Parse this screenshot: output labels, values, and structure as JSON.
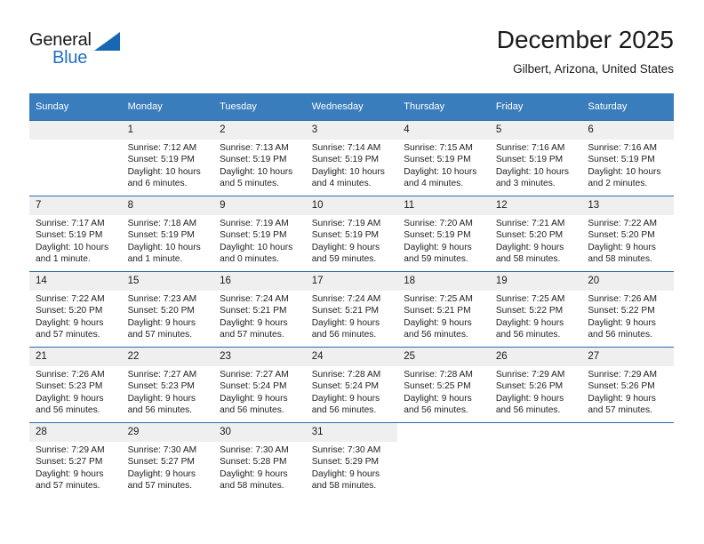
{
  "brand": {
    "name_part1": "General",
    "name_part2": "Blue",
    "triangle_icon": "triangle-icon",
    "accent_color": "#1668b3"
  },
  "header": {
    "title": "December 2025",
    "subtitle": "Gilbert, Arizona, United States"
  },
  "theme": {
    "header_bar_color": "#3a7dbd",
    "row_divider_color": "#2a6cad",
    "daynum_band_color": "#efefef"
  },
  "calendar": {
    "weekday_headers": [
      "Sunday",
      "Monday",
      "Tuesday",
      "Wednesday",
      "Thursday",
      "Friday",
      "Saturday"
    ],
    "weeks": [
      [
        {
          "day": "",
          "sunrise": "",
          "sunset": "",
          "daylight_line1": "",
          "daylight_line2": ""
        },
        {
          "day": "1",
          "sunrise": "Sunrise: 7:12 AM",
          "sunset": "Sunset: 5:19 PM",
          "daylight_line1": "Daylight: 10 hours",
          "daylight_line2": "and 6 minutes."
        },
        {
          "day": "2",
          "sunrise": "Sunrise: 7:13 AM",
          "sunset": "Sunset: 5:19 PM",
          "daylight_line1": "Daylight: 10 hours",
          "daylight_line2": "and 5 minutes."
        },
        {
          "day": "3",
          "sunrise": "Sunrise: 7:14 AM",
          "sunset": "Sunset: 5:19 PM",
          "daylight_line1": "Daylight: 10 hours",
          "daylight_line2": "and 4 minutes."
        },
        {
          "day": "4",
          "sunrise": "Sunrise: 7:15 AM",
          "sunset": "Sunset: 5:19 PM",
          "daylight_line1": "Daylight: 10 hours",
          "daylight_line2": "and 4 minutes."
        },
        {
          "day": "5",
          "sunrise": "Sunrise: 7:16 AM",
          "sunset": "Sunset: 5:19 PM",
          "daylight_line1": "Daylight: 10 hours",
          "daylight_line2": "and 3 minutes."
        },
        {
          "day": "6",
          "sunrise": "Sunrise: 7:16 AM",
          "sunset": "Sunset: 5:19 PM",
          "daylight_line1": "Daylight: 10 hours",
          "daylight_line2": "and 2 minutes."
        }
      ],
      [
        {
          "day": "7",
          "sunrise": "Sunrise: 7:17 AM",
          "sunset": "Sunset: 5:19 PM",
          "daylight_line1": "Daylight: 10 hours",
          "daylight_line2": "and 1 minute."
        },
        {
          "day": "8",
          "sunrise": "Sunrise: 7:18 AM",
          "sunset": "Sunset: 5:19 PM",
          "daylight_line1": "Daylight: 10 hours",
          "daylight_line2": "and 1 minute."
        },
        {
          "day": "9",
          "sunrise": "Sunrise: 7:19 AM",
          "sunset": "Sunset: 5:19 PM",
          "daylight_line1": "Daylight: 10 hours",
          "daylight_line2": "and 0 minutes."
        },
        {
          "day": "10",
          "sunrise": "Sunrise: 7:19 AM",
          "sunset": "Sunset: 5:19 PM",
          "daylight_line1": "Daylight: 9 hours",
          "daylight_line2": "and 59 minutes."
        },
        {
          "day": "11",
          "sunrise": "Sunrise: 7:20 AM",
          "sunset": "Sunset: 5:19 PM",
          "daylight_line1": "Daylight: 9 hours",
          "daylight_line2": "and 59 minutes."
        },
        {
          "day": "12",
          "sunrise": "Sunrise: 7:21 AM",
          "sunset": "Sunset: 5:20 PM",
          "daylight_line1": "Daylight: 9 hours",
          "daylight_line2": "and 58 minutes."
        },
        {
          "day": "13",
          "sunrise": "Sunrise: 7:22 AM",
          "sunset": "Sunset: 5:20 PM",
          "daylight_line1": "Daylight: 9 hours",
          "daylight_line2": "and 58 minutes."
        }
      ],
      [
        {
          "day": "14",
          "sunrise": "Sunrise: 7:22 AM",
          "sunset": "Sunset: 5:20 PM",
          "daylight_line1": "Daylight: 9 hours",
          "daylight_line2": "and 57 minutes."
        },
        {
          "day": "15",
          "sunrise": "Sunrise: 7:23 AM",
          "sunset": "Sunset: 5:20 PM",
          "daylight_line1": "Daylight: 9 hours",
          "daylight_line2": "and 57 minutes."
        },
        {
          "day": "16",
          "sunrise": "Sunrise: 7:24 AM",
          "sunset": "Sunset: 5:21 PM",
          "daylight_line1": "Daylight: 9 hours",
          "daylight_line2": "and 57 minutes."
        },
        {
          "day": "17",
          "sunrise": "Sunrise: 7:24 AM",
          "sunset": "Sunset: 5:21 PM",
          "daylight_line1": "Daylight: 9 hours",
          "daylight_line2": "and 56 minutes."
        },
        {
          "day": "18",
          "sunrise": "Sunrise: 7:25 AM",
          "sunset": "Sunset: 5:21 PM",
          "daylight_line1": "Daylight: 9 hours",
          "daylight_line2": "and 56 minutes."
        },
        {
          "day": "19",
          "sunrise": "Sunrise: 7:25 AM",
          "sunset": "Sunset: 5:22 PM",
          "daylight_line1": "Daylight: 9 hours",
          "daylight_line2": "and 56 minutes."
        },
        {
          "day": "20",
          "sunrise": "Sunrise: 7:26 AM",
          "sunset": "Sunset: 5:22 PM",
          "daylight_line1": "Daylight: 9 hours",
          "daylight_line2": "and 56 minutes."
        }
      ],
      [
        {
          "day": "21",
          "sunrise": "Sunrise: 7:26 AM",
          "sunset": "Sunset: 5:23 PM",
          "daylight_line1": "Daylight: 9 hours",
          "daylight_line2": "and 56 minutes."
        },
        {
          "day": "22",
          "sunrise": "Sunrise: 7:27 AM",
          "sunset": "Sunset: 5:23 PM",
          "daylight_line1": "Daylight: 9 hours",
          "daylight_line2": "and 56 minutes."
        },
        {
          "day": "23",
          "sunrise": "Sunrise: 7:27 AM",
          "sunset": "Sunset: 5:24 PM",
          "daylight_line1": "Daylight: 9 hours",
          "daylight_line2": "and 56 minutes."
        },
        {
          "day": "24",
          "sunrise": "Sunrise: 7:28 AM",
          "sunset": "Sunset: 5:24 PM",
          "daylight_line1": "Daylight: 9 hours",
          "daylight_line2": "and 56 minutes."
        },
        {
          "day": "25",
          "sunrise": "Sunrise: 7:28 AM",
          "sunset": "Sunset: 5:25 PM",
          "daylight_line1": "Daylight: 9 hours",
          "daylight_line2": "and 56 minutes."
        },
        {
          "day": "26",
          "sunrise": "Sunrise: 7:29 AM",
          "sunset": "Sunset: 5:26 PM",
          "daylight_line1": "Daylight: 9 hours",
          "daylight_line2": "and 56 minutes."
        },
        {
          "day": "27",
          "sunrise": "Sunrise: 7:29 AM",
          "sunset": "Sunset: 5:26 PM",
          "daylight_line1": "Daylight: 9 hours",
          "daylight_line2": "and 57 minutes."
        }
      ],
      [
        {
          "day": "28",
          "sunrise": "Sunrise: 7:29 AM",
          "sunset": "Sunset: 5:27 PM",
          "daylight_line1": "Daylight: 9 hours",
          "daylight_line2": "and 57 minutes."
        },
        {
          "day": "29",
          "sunrise": "Sunrise: 7:30 AM",
          "sunset": "Sunset: 5:27 PM",
          "daylight_line1": "Daylight: 9 hours",
          "daylight_line2": "and 57 minutes."
        },
        {
          "day": "30",
          "sunrise": "Sunrise: 7:30 AM",
          "sunset": "Sunset: 5:28 PM",
          "daylight_line1": "Daylight: 9 hours",
          "daylight_line2": "and 58 minutes."
        },
        {
          "day": "31",
          "sunrise": "Sunrise: 7:30 AM",
          "sunset": "Sunset: 5:29 PM",
          "daylight_line1": "Daylight: 9 hours",
          "daylight_line2": "and 58 minutes."
        },
        {
          "day": "",
          "sunrise": "",
          "sunset": "",
          "daylight_line1": "",
          "daylight_line2": ""
        },
        {
          "day": "",
          "sunrise": "",
          "sunset": "",
          "daylight_line1": "",
          "daylight_line2": ""
        },
        {
          "day": "",
          "sunrise": "",
          "sunset": "",
          "daylight_line1": "",
          "daylight_line2": ""
        }
      ]
    ]
  }
}
